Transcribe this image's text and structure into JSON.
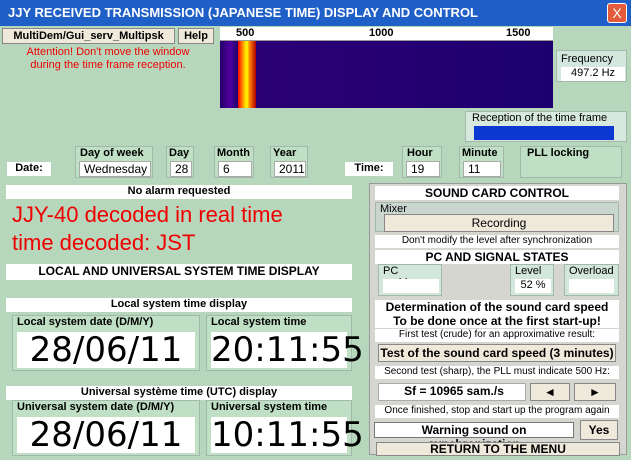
{
  "window": {
    "title": "JJY RECEIVED TRANSMISSION (JAPANESE TIME) DISPLAY AND CONTROL",
    "close_label": "X"
  },
  "top_left": {
    "multidem_button": "MultiDem/Gui_serv_Multipsk",
    "help_button": "Help",
    "warning_line1": "Attention! Don't move the window",
    "warning_line2": "during the time frame reception."
  },
  "spectrum": {
    "scale": [
      "500",
      "1000",
      "1500"
    ]
  },
  "frequency": {
    "label": "Frequency",
    "value": "497.2 Hz"
  },
  "reception": {
    "label": "Reception of the time frame"
  },
  "date_row": {
    "date_label": "Date:",
    "dow_label": "Day of week",
    "dow_value": "Wednesday",
    "day_label": "Day",
    "day_value": "28",
    "month_label": "Month",
    "month_value": "6",
    "year_label": "Year",
    "year_value": "2011",
    "time_label": "Time:",
    "hour_label": "Hour",
    "hour_value": "19",
    "minute_label": "Minute",
    "minute_value": "11",
    "pll_label": "PLL locking"
  },
  "left": {
    "alarm": "No alarm requested",
    "decoded_line1": "JJY-40 decoded in real time",
    "decoded_line2": "time decoded: JST",
    "local_universal_title": "LOCAL AND UNIVERSAL SYSTEM TIME DISPLAY",
    "local_title": "Local system time display",
    "local_date_label": "Local system date (D/M/Y)",
    "local_time_label": "Local system time",
    "local_date": "28/06/11",
    "local_time": "20:11:55",
    "utc_title": "Universal  système time (UTC) display",
    "utc_date_label": "Universal system date (D/M/Y)",
    "utc_time_label": "Universal system time",
    "utc_date": "28/06/11",
    "utc_time": "10:11:55"
  },
  "right": {
    "sound_title": "SOUND CARD CONTROL",
    "mixer_label": "Mixer",
    "recording": "Recording",
    "dont_modify": "Don't modify the level after synchronization",
    "pc_signal_title": "PC AND SIGNAL STATES",
    "pc_problem": "PC problem",
    "level_label": "Level",
    "level_value": "52 %",
    "overload": "Overload",
    "determination_line1": "Determination of the sound card speed",
    "determination_line2": "To be done once at the first start-up!",
    "first_test": "First test (crude) for an approximative result:",
    "test_button": "Test of the sound card speed (3 minutes)",
    "second_test": "Second test (sharp), the PLL must indicate 500 Hz:",
    "sf_value": "Sf = 10965 sam./s",
    "left_arrow": "◄",
    "right_arrow": "►",
    "once_finished": "Once finished, stop and start up the program again",
    "warning_sound": "Warning sound on synchronization",
    "yes": "Yes",
    "return": "RETURN TO THE MENU"
  }
}
